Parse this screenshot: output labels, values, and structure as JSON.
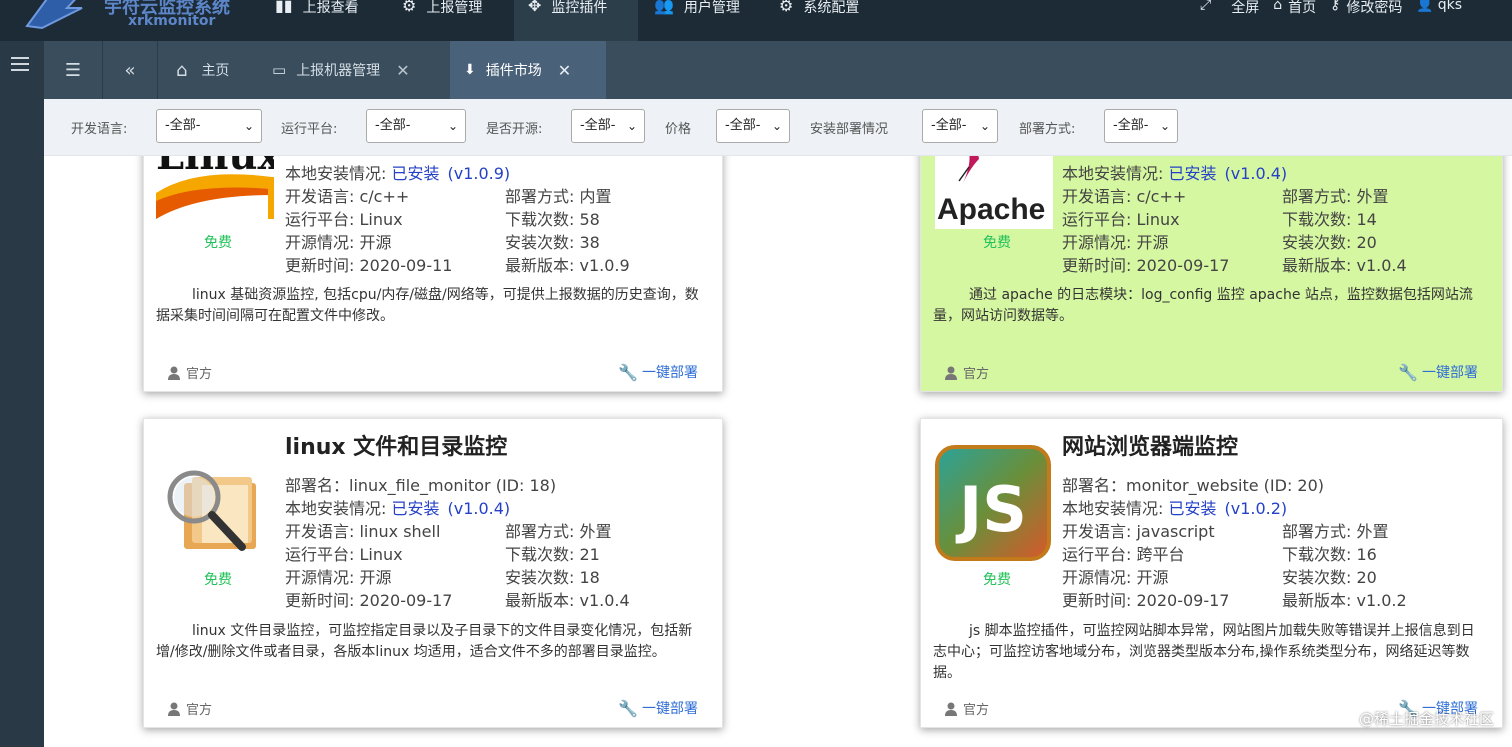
{
  "brand": {
    "title": "宇符云监控系统",
    "subtitle": "xrkmonitor"
  },
  "topnav": {
    "items": [
      {
        "label": "上报查看",
        "icon": "chart-icon"
      },
      {
        "label": "上报管理",
        "icon": "gears-icon"
      },
      {
        "label": "监控插件",
        "icon": "move-icon"
      },
      {
        "label": "用户管理",
        "icon": "users-icon"
      },
      {
        "label": "系统配置",
        "icon": "gear-icon"
      }
    ],
    "active_index": 2,
    "right": {
      "fullscreen": "全屏",
      "home": "首页",
      "change_password": "修改密码",
      "user": "qks"
    }
  },
  "tabs": {
    "home_label": "主页",
    "items": [
      {
        "label": "上报机器管理",
        "active": false
      },
      {
        "label": "插件市场",
        "active": true
      }
    ]
  },
  "filters": [
    {
      "label": "开发语言:",
      "value": "-全部-"
    },
    {
      "label": "运行平台:",
      "value": "-全部-"
    },
    {
      "label": "是否开源:",
      "value": "-全部-"
    },
    {
      "label": "价格",
      "value": "-全部-"
    },
    {
      "label": "安装部署情况",
      "value": "-全部-"
    },
    {
      "label": "部署方式:",
      "value": "-全部-"
    }
  ],
  "labels": {
    "local_install": "本地安装情况: ",
    "free": "免费",
    "author": "官方",
    "deploy": "一键部署"
  },
  "plugins": [
    {
      "title": "",
      "deploy_name": "",
      "install_status": "已安装",
      "install_version": "(v1.0.9)",
      "lang": "开发语言: c/c++",
      "platform": "运行平台: Linux",
      "opensource": "开源情况: 开源",
      "updated": "更新时间: 2020-09-11",
      "deploy_mode": "部署方式: 内置",
      "downloads": "下载次数: 58",
      "installs": "安装次数: 38",
      "latest": "最新版本: v1.0.9",
      "desc": "linux 基础资源监控, 包括cpu/内存/磁盘/网络等，可提供上报数据的历史查询，数据采集时间间隔可在配置文件中修改。",
      "logo_text": "Linux",
      "highlighted": false
    },
    {
      "title": "",
      "deploy_name": "",
      "install_status": "已安装",
      "install_version": "(v1.0.4)",
      "lang": "开发语言: c/c++",
      "platform": "运行平台: Linux",
      "opensource": "开源情况: 开源",
      "updated": "更新时间: 2020-09-17",
      "deploy_mode": "部署方式: 外置",
      "downloads": "下载次数: 14",
      "installs": "安装次数: 20",
      "latest": "最新版本: v1.0.4",
      "desc": "通过 apache 的日志模块：log_config 监控 apache 站点，监控数据包括网站流量，网站访问数据等。",
      "logo_text": "Apache",
      "highlighted": true
    },
    {
      "title": "linux 文件和目录监控",
      "deploy_name": "部署名：linux_file_monitor (ID: 18)",
      "install_status": "已安装",
      "install_version": "(v1.0.4)",
      "lang": "开发语言: linux shell",
      "platform": "运行平台: Linux",
      "opensource": "开源情况: 开源",
      "updated": "更新时间: 2020-09-17",
      "deploy_mode": "部署方式: 外置",
      "downloads": "下载次数: 21",
      "installs": "安装次数: 18",
      "latest": "最新版本: v1.0.4",
      "desc": "linux 文件目录监控，可监控指定目录以及子目录下的文件目录变化情况，包括新增/修改/删除文件或者目录，各版本linux 均适用，适合文件不多的部署目录监控。",
      "logo_text": "",
      "highlighted": false
    },
    {
      "title": "网站浏览器端监控",
      "deploy_name": "部署名：monitor_website (ID: 20)",
      "install_status": "已安装",
      "install_version": "(v1.0.2)",
      "lang": "开发语言: javascript",
      "platform": "运行平台: 跨平台",
      "opensource": "开源情况: 开源",
      "updated": "更新时间: 2020-09-17",
      "deploy_mode": "部署方式: 外置",
      "downloads": "下载次数: 16",
      "installs": "安装次数: 20",
      "latest": "最新版本: v1.0.2",
      "desc": "js 脚本监控插件，可监控网站脚本异常，网站图片加载失败等错误并上报信息到日志中心；可监控访客地域分布，浏览器类型版本分布,操作系统类型分布，网络延迟等数据。",
      "logo_text": "JS",
      "highlighted": false
    }
  ],
  "watermark": "@稀土掘金技术社区"
}
